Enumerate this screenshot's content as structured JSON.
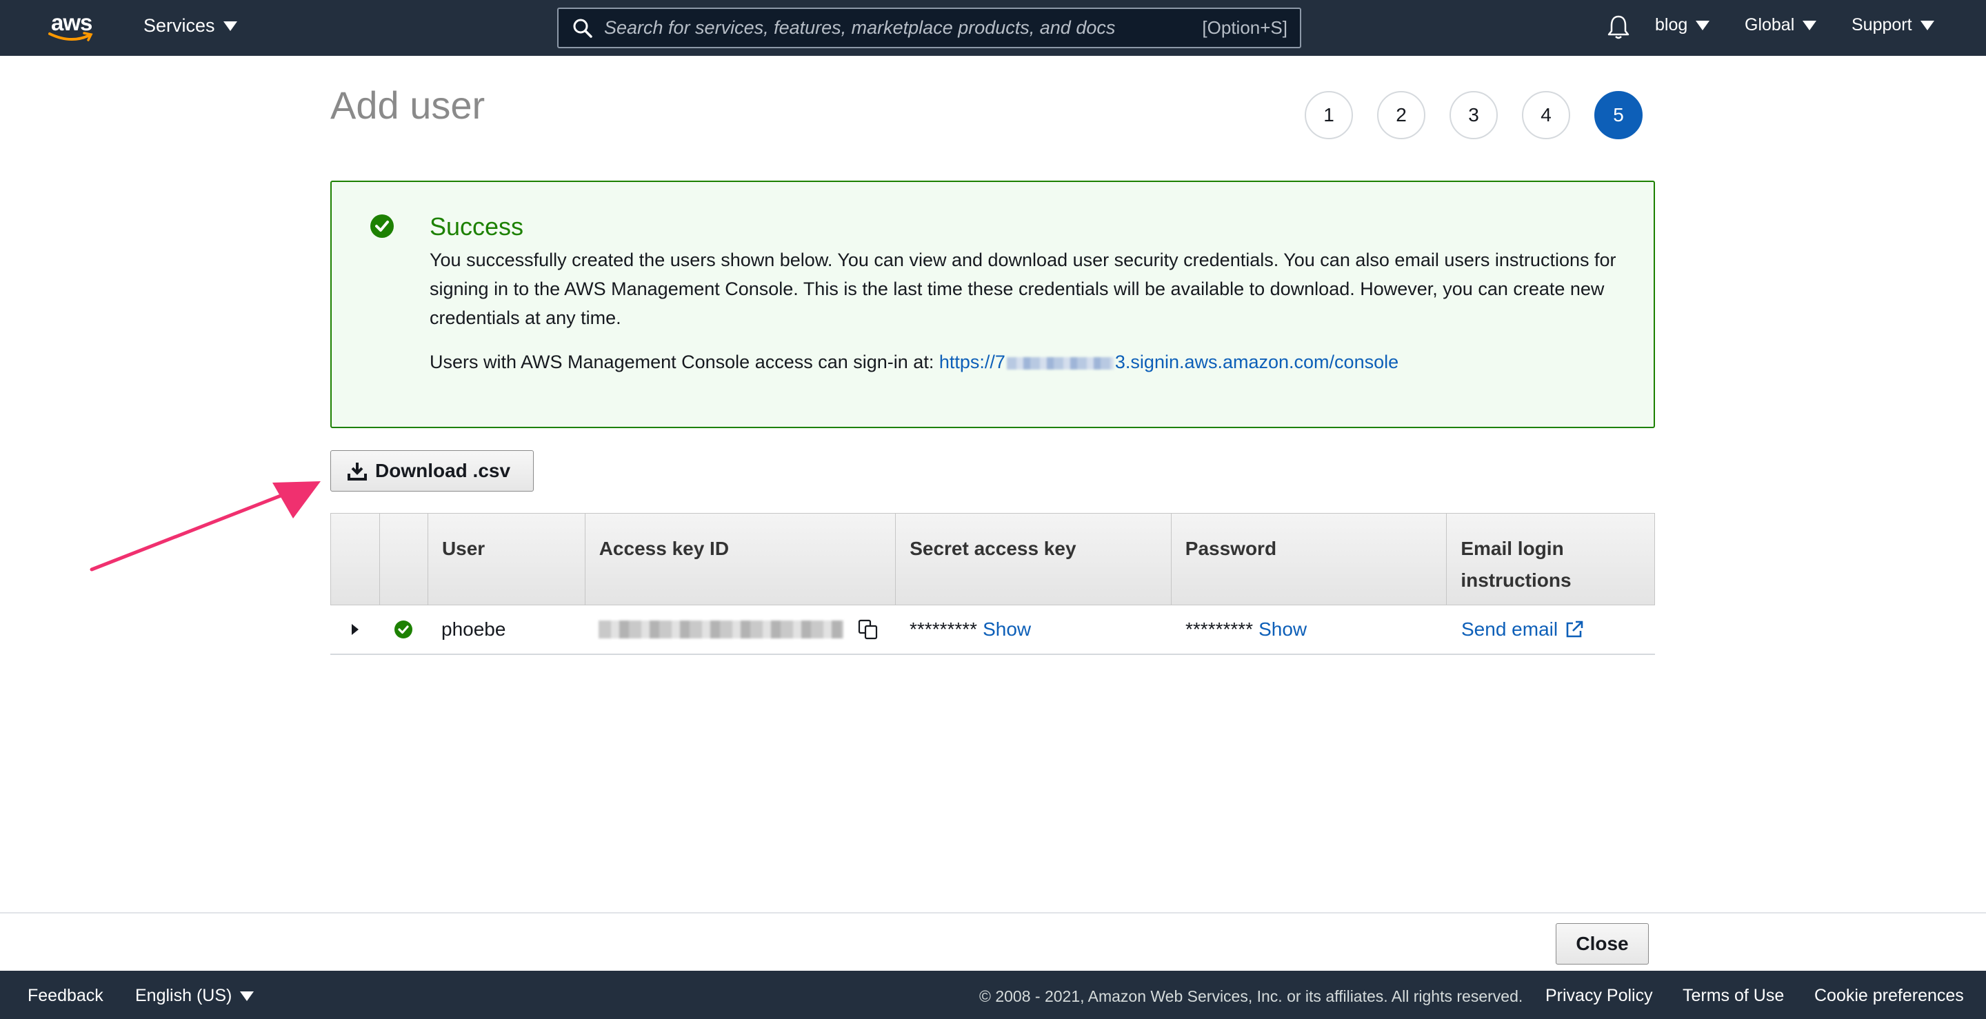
{
  "topnav": {
    "logo_text": "aws",
    "services_label": "Services",
    "search_placeholder": "Search for services, features, marketplace products, and docs",
    "search_shortcut": "[Option+S]",
    "account_label": "blog",
    "region_label": "Global",
    "support_label": "Support"
  },
  "page": {
    "title": "Add user",
    "steps": [
      "1",
      "2",
      "3",
      "4",
      "5"
    ],
    "active_step": "5"
  },
  "success": {
    "title": "Success",
    "body": "You successfully created the users shown below. You can view and download user security credentials. You can also email users instructions for signing in to the AWS Management Console. This is the last time these credentials will be available to download. However, you can create new credentials at any time.",
    "signin_text": "Users with AWS Management Console access can sign-in at:",
    "signin_url_prefix": "https://7",
    "signin_url_suffix": "3.signin.aws.amazon.com/console"
  },
  "download_label": "Download .csv",
  "table": {
    "headers": [
      "",
      "",
      "User",
      "Access key ID",
      "Secret access key",
      "Password",
      "Email login instructions"
    ],
    "rows": [
      {
        "user": "phoebe",
        "secret_masked": "*********",
        "secret_show": "Show",
        "password_masked": "*********",
        "password_show": "Show",
        "email_action": "Send email"
      }
    ]
  },
  "close_label": "Close",
  "footer": {
    "feedback": "Feedback",
    "language": "English (US)",
    "copyright": "© 2008 - 2021, Amazon Web Services, Inc. or its affiliates. All rights reserved.",
    "privacy": "Privacy Policy",
    "terms": "Terms of Use",
    "cookies": "Cookie preferences"
  },
  "colors": {
    "nav_bg": "#232f3e",
    "success_green": "#1d8102",
    "link_blue": "#0d5fb8",
    "annotation_pink": "#f0306f"
  }
}
